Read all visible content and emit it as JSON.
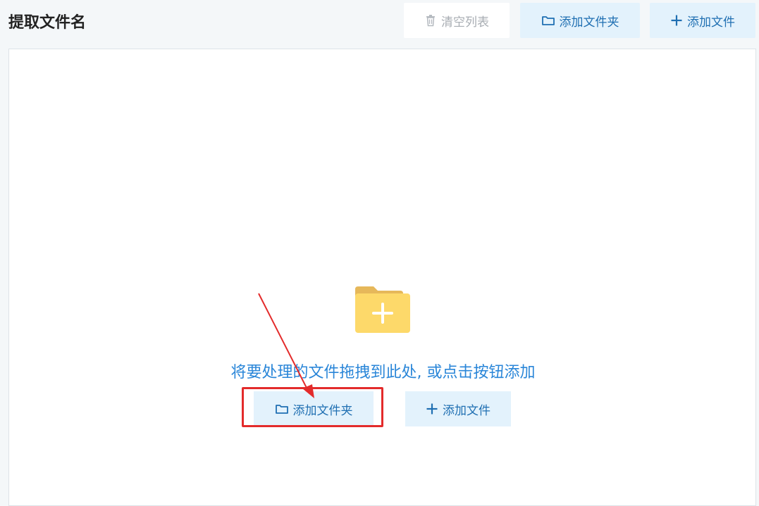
{
  "header": {
    "title": "提取文件名",
    "buttons": {
      "clear_list": "清空列表",
      "add_folder": "添加文件夹",
      "add_file": "添加文件"
    }
  },
  "dropzone": {
    "hint": "将要处理的文件拖拽到此处, 或点击按钮添加",
    "add_folder": "添加文件夹",
    "add_file": "添加文件"
  },
  "colors": {
    "accent": "#2a86d8",
    "button_bg": "#e3f2fc",
    "highlight": "#e32b2b",
    "folder": "#fdd96a"
  },
  "icons": [
    "trash-icon",
    "folder-icon",
    "plus-icon",
    "folder-add-icon"
  ]
}
